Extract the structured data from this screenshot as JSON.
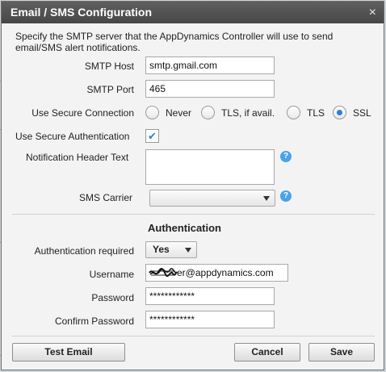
{
  "dialog": {
    "title": "Email / SMS Configuration",
    "close_glyph": "×",
    "description": "Specify the SMTP server that the AppDynamics Controller will use to send email/SMS alert notifications."
  },
  "smtp": {
    "host_label": "SMTP Host",
    "host_value": "smtp.gmail.com",
    "port_label": "SMTP Port",
    "port_value": "465"
  },
  "secure_connection": {
    "label": "Use Secure Connection",
    "options": [
      "Never",
      "TLS, if avail.",
      "TLS",
      "SSL"
    ],
    "selected": "SSL"
  },
  "secure_auth": {
    "label": "Use Secure Authentication",
    "checked": true,
    "check_glyph": "✔"
  },
  "notification_header": {
    "label": "Notification Header Text",
    "value": "",
    "help_glyph": "?"
  },
  "sms_carrier": {
    "label": "SMS Carrier",
    "value": "",
    "help_glyph": "?"
  },
  "authentication": {
    "section_title": "Authentication",
    "required_label": "Authentication required",
    "required_value": "Yes",
    "username_label": "Username",
    "username_visible_text": "er@appdynamics.com",
    "password_label": "Password",
    "password_value": "************",
    "confirm_label": "Confirm Password",
    "confirm_value": "************"
  },
  "buttons": {
    "test_email": "Test Email",
    "cancel": "Cancel",
    "save": "Save"
  },
  "colors": {
    "accent": "#2c7de1",
    "help": "#4aa3e8",
    "titlebar": "#4f4f4f"
  },
  "icons": {
    "close": "close-icon",
    "help": "help-icon",
    "dropdown": "chevron-down-icon",
    "check": "checkmark-icon"
  }
}
